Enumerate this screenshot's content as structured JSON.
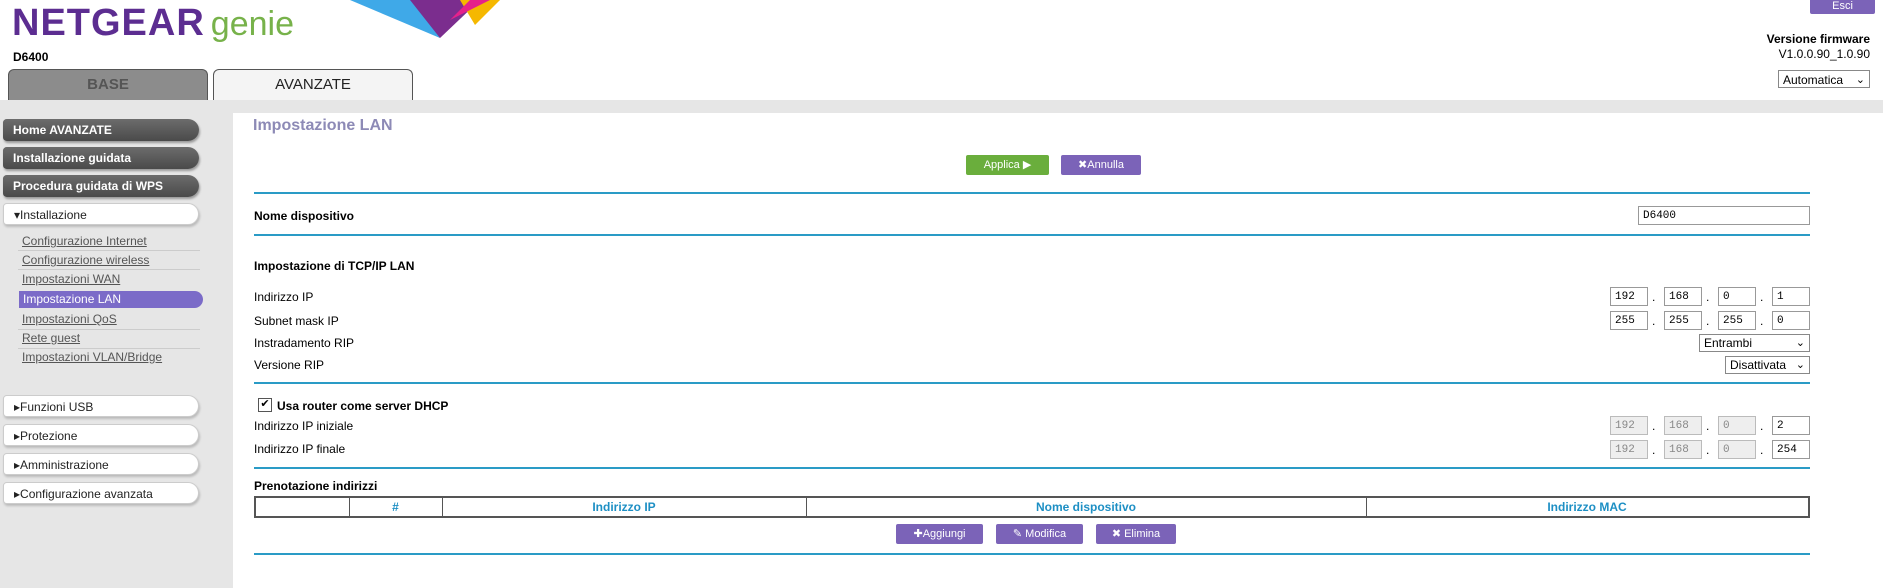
{
  "header": {
    "brand_name": "NETGEAR",
    "brand_product": "genie",
    "model": "D6400",
    "logout_label": "Esci",
    "firmware_title": "Versione firmware",
    "firmware_version": "V1.0.0.90_1.0.90",
    "language": "Automatica",
    "tabs": [
      {
        "label": "BASE",
        "active": false
      },
      {
        "label": "AVANZATE",
        "active": true
      }
    ]
  },
  "sidebar": {
    "top_buttons": [
      "Home AVANZATE",
      "Installazione guidata",
      "Procedura guidata di WPS"
    ],
    "section_open": "Installazione",
    "sub_items": [
      "Configurazione Internet",
      "Configurazione wireless",
      "Impostazioni WAN",
      "Impostazione LAN",
      "Impostazioni QoS",
      "Rete guest",
      "Impostazioni VLAN/Bridge"
    ],
    "active_item": "Impostazione LAN",
    "collapsed_sections": [
      "Funzioni USB",
      "Protezione",
      "Amministrazione",
      "Configurazione avanzata"
    ]
  },
  "main": {
    "title": "Impostazione LAN",
    "apply_label": "Applica",
    "cancel_label": "Annulla",
    "device_name_label": "Nome dispositivo",
    "device_name_value": "D6400",
    "tcpip_heading": "Impostazione di TCP/IP LAN",
    "ip_label": "Indirizzo IP",
    "ip_octets": [
      "192",
      "168",
      "0",
      "1"
    ],
    "subnet_label": "Subnet mask IP",
    "subnet_octets": [
      "255",
      "255",
      "255",
      "0"
    ],
    "rip_dir_label": "Instradamento RIP",
    "rip_dir_value": "Entrambi",
    "rip_ver_label": "Versione RIP",
    "rip_ver_value": "Disattivata",
    "dhcp_checkbox_label": "Usa router come server DHCP",
    "dhcp_checked": true,
    "start_ip_label": "Indirizzo IP iniziale",
    "start_ip_octets": [
      "192",
      "168",
      "0",
      "2"
    ],
    "end_ip_label": "Indirizzo IP finale",
    "end_ip_octets": [
      "192",
      "168",
      "0",
      "254"
    ],
    "reservation_heading": "Prenotazione indirizzi",
    "table_headers": [
      "",
      "#",
      "Indirizzo IP",
      "Nome dispositivo",
      "Indirizzo MAC"
    ],
    "add_label": "Aggiungi",
    "edit_label": "Modifica",
    "delete_label": "Elimina"
  },
  "colors": {
    "accent_purple": "#7b63b8",
    "apply_green": "#6aae3c",
    "divider_blue": "#2a9bc6",
    "header_text_blue": "#1d8fc4"
  }
}
